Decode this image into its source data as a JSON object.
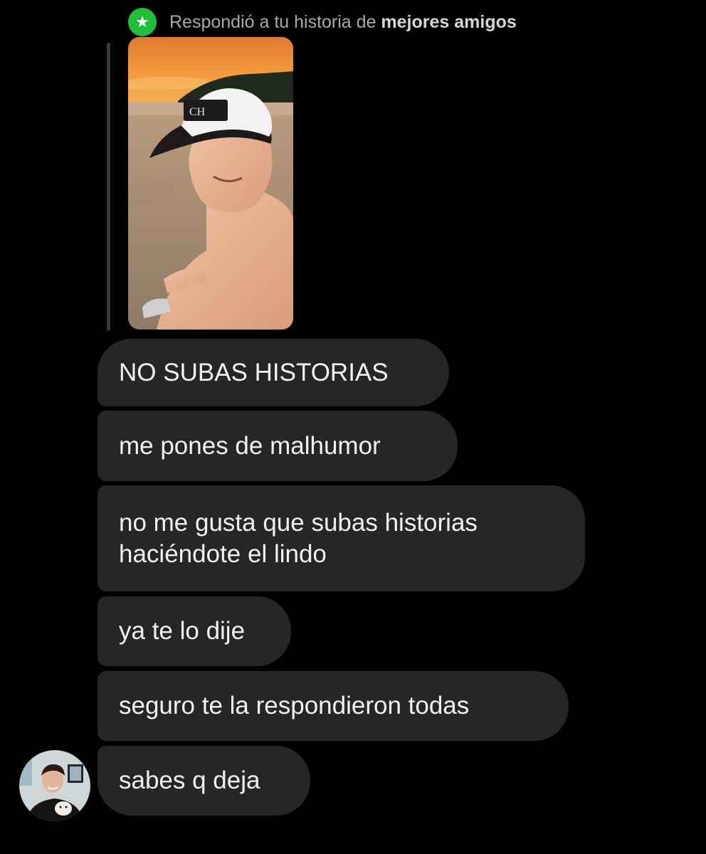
{
  "reply_header": {
    "prefix": "Respondió a tu historia de",
    "highlight": "mejores amigos",
    "badge_icon": "star-icon",
    "badge_color": "#1fbf3a"
  },
  "story": {
    "thumbnail": "beach-sunset-photo"
  },
  "messages": [
    {
      "text": "NO SUBAS HISTORIAS"
    },
    {
      "text": "me pones de malhumor"
    },
    {
      "text": "no me gusta que subas historias haciéndote el lindo"
    },
    {
      "text": "ya te lo dije"
    },
    {
      "text": "seguro te la respondieron todas"
    },
    {
      "text": "sabes q deja"
    }
  ],
  "colors": {
    "background": "#000000",
    "bubble": "#262626",
    "text": "#f2f2f2"
  }
}
